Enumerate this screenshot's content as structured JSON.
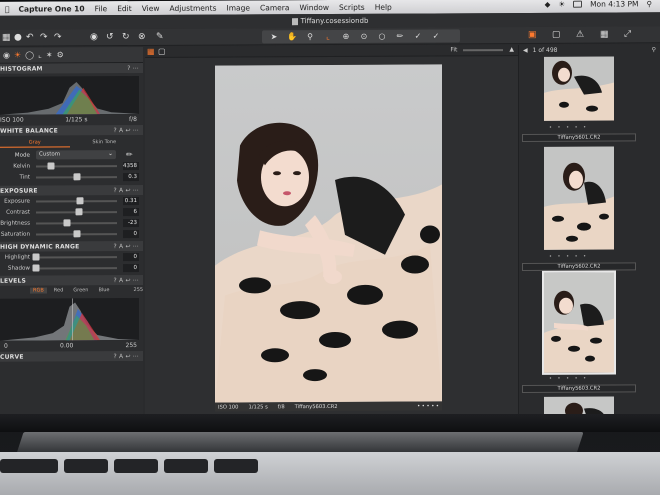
{
  "menubar": {
    "app": "Capture One 10",
    "items": [
      "File",
      "Edit",
      "View",
      "Adjustments",
      "Image",
      "Camera",
      "Window",
      "Scripts",
      "Help"
    ],
    "clock": "Mon 4:13 PM"
  },
  "window": {
    "title": "Tiffany.cosessiondb"
  },
  "left_panel": {
    "histogram": {
      "title": "HISTOGRAM",
      "info": {
        "iso": "ISO 100",
        "shutter": "1/125 s",
        "aperture": "f/8"
      }
    },
    "white_balance": {
      "title": "WHITE BALANCE",
      "tabs": [
        "Gray",
        "Skin Tone"
      ],
      "mode_label": "Mode",
      "mode_value": "Custom",
      "sliders": [
        {
          "label": "Kelvin",
          "value": "4358",
          "pos": 0.18
        },
        {
          "label": "Tint",
          "value": "0.3",
          "pos": 0.5
        }
      ]
    },
    "exposure": {
      "title": "EXPOSURE",
      "sliders": [
        {
          "label": "Exposure",
          "value": "0.31",
          "pos": 0.54
        },
        {
          "label": "Contrast",
          "value": "6",
          "pos": 0.53
        },
        {
          "label": "Brightness",
          "value": "-23",
          "pos": 0.38
        },
        {
          "label": "Saturation",
          "value": "0",
          "pos": 0.5
        }
      ]
    },
    "hdr": {
      "title": "HIGH DYNAMIC RANGE",
      "sliders": [
        {
          "label": "Highlight",
          "value": "0",
          "pos": 0.0
        },
        {
          "label": "Shadow",
          "value": "0",
          "pos": 0.0
        }
      ]
    },
    "levels": {
      "title": "LEVELS",
      "tabs": [
        "RGB",
        "Red",
        "Green",
        "Blue"
      ],
      "top_value": "255",
      "bottom_values": [
        "0",
        "0.00",
        "255"
      ]
    },
    "curve": {
      "title": "CURVE"
    }
  },
  "viewer": {
    "fit_label": "Fit",
    "info": {
      "iso": "ISO 100",
      "shutter": "1/125 s",
      "aperture": "f/8",
      "filename": "Tiffany5603.CR2"
    }
  },
  "browser": {
    "count": "1 of 498",
    "thumbs": [
      {
        "name": "Tiffany5601.CR2"
      },
      {
        "name": "Tiffany5602.CR2"
      },
      {
        "name": "Tiffany5603.CR2",
        "selected": true
      }
    ],
    "star_glyphs": "• • • • •"
  },
  "colors": {
    "accent": "#ff7a2e",
    "panel": "#2c2d2f",
    "photo_bg": "#c7c8c6"
  }
}
